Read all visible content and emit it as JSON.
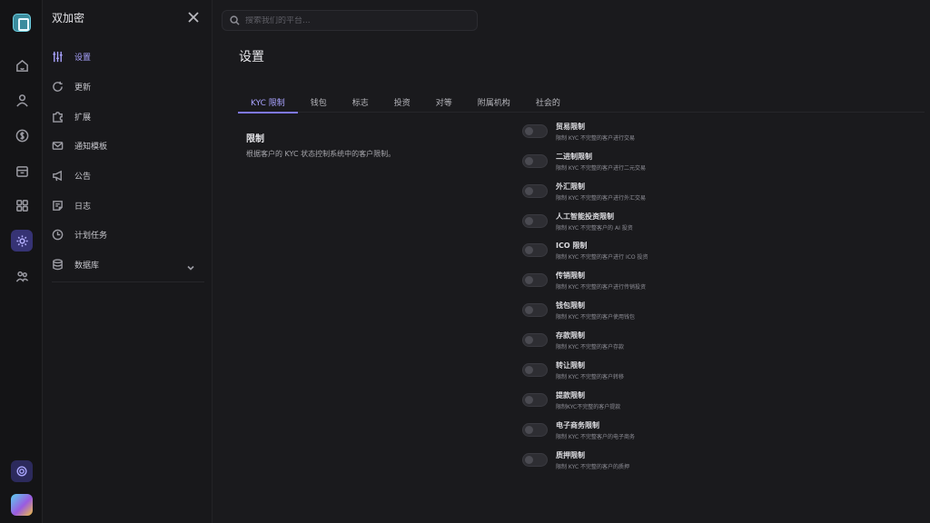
{
  "sidebar": {
    "title": "双加密",
    "items": [
      {
        "label": "设置",
        "icon": "sliders-icon",
        "active": true
      },
      {
        "label": "更新",
        "icon": "refresh-icon"
      },
      {
        "label": "扩展",
        "icon": "puzzle-icon"
      },
      {
        "label": "通知模板",
        "icon": "mail-icon"
      },
      {
        "label": "公告",
        "icon": "megaphone-icon"
      },
      {
        "label": "日志",
        "icon": "note-icon"
      },
      {
        "label": "计划任务",
        "icon": "clock-icon"
      },
      {
        "label": "数据库",
        "icon": "database-icon"
      }
    ]
  },
  "search": {
    "placeholder": "搜索我们的平台..."
  },
  "main": {
    "title": "设置",
    "tabs": [
      "KYC 限制",
      "钱包",
      "标志",
      "投资",
      "对等",
      "附属机构",
      "社会的"
    ],
    "section": {
      "title": "限制",
      "description": "根据客户的 KYC 状态控制系统中的客户限制。"
    },
    "toggles": [
      {
        "title": "贸易限制",
        "desc": "限制 KYC 不完整的客户进行交易",
        "on": false
      },
      {
        "title": "二进制限制",
        "desc": "限制 KYC 不完整的客户进行二元交易",
        "on": false
      },
      {
        "title": "外汇限制",
        "desc": "限制 KYC 不完整的客户进行外汇交易",
        "on": false
      },
      {
        "title": "人工智能投资限制",
        "desc": "限制 KYC 不完整客户的 AI 投资",
        "on": false
      },
      {
        "title": "ICO 限制",
        "desc": "限制 KYC 不完整的客户进行 ICO 投资",
        "on": false
      },
      {
        "title": "传销限制",
        "desc": "限制 KYC 不完整的客户进行传销投资",
        "on": false
      },
      {
        "title": "钱包限制",
        "desc": "限制 KYC 不完整的客户使用钱包",
        "on": false
      },
      {
        "title": "存款限制",
        "desc": "限制 KYC 不完整的客户存款",
        "on": false
      },
      {
        "title": "转让限制",
        "desc": "限制 KYC 不完整的客户转移",
        "on": false
      },
      {
        "title": "提款限制",
        "desc": "限制KYC不完整的客户提款",
        "on": false
      },
      {
        "title": "电子商务限制",
        "desc": "限制 KYC 不完整客户的电子商务",
        "on": false
      },
      {
        "title": "质押限制",
        "desc": "限制 KYC 不完整的客户的质押",
        "on": false
      }
    ]
  }
}
